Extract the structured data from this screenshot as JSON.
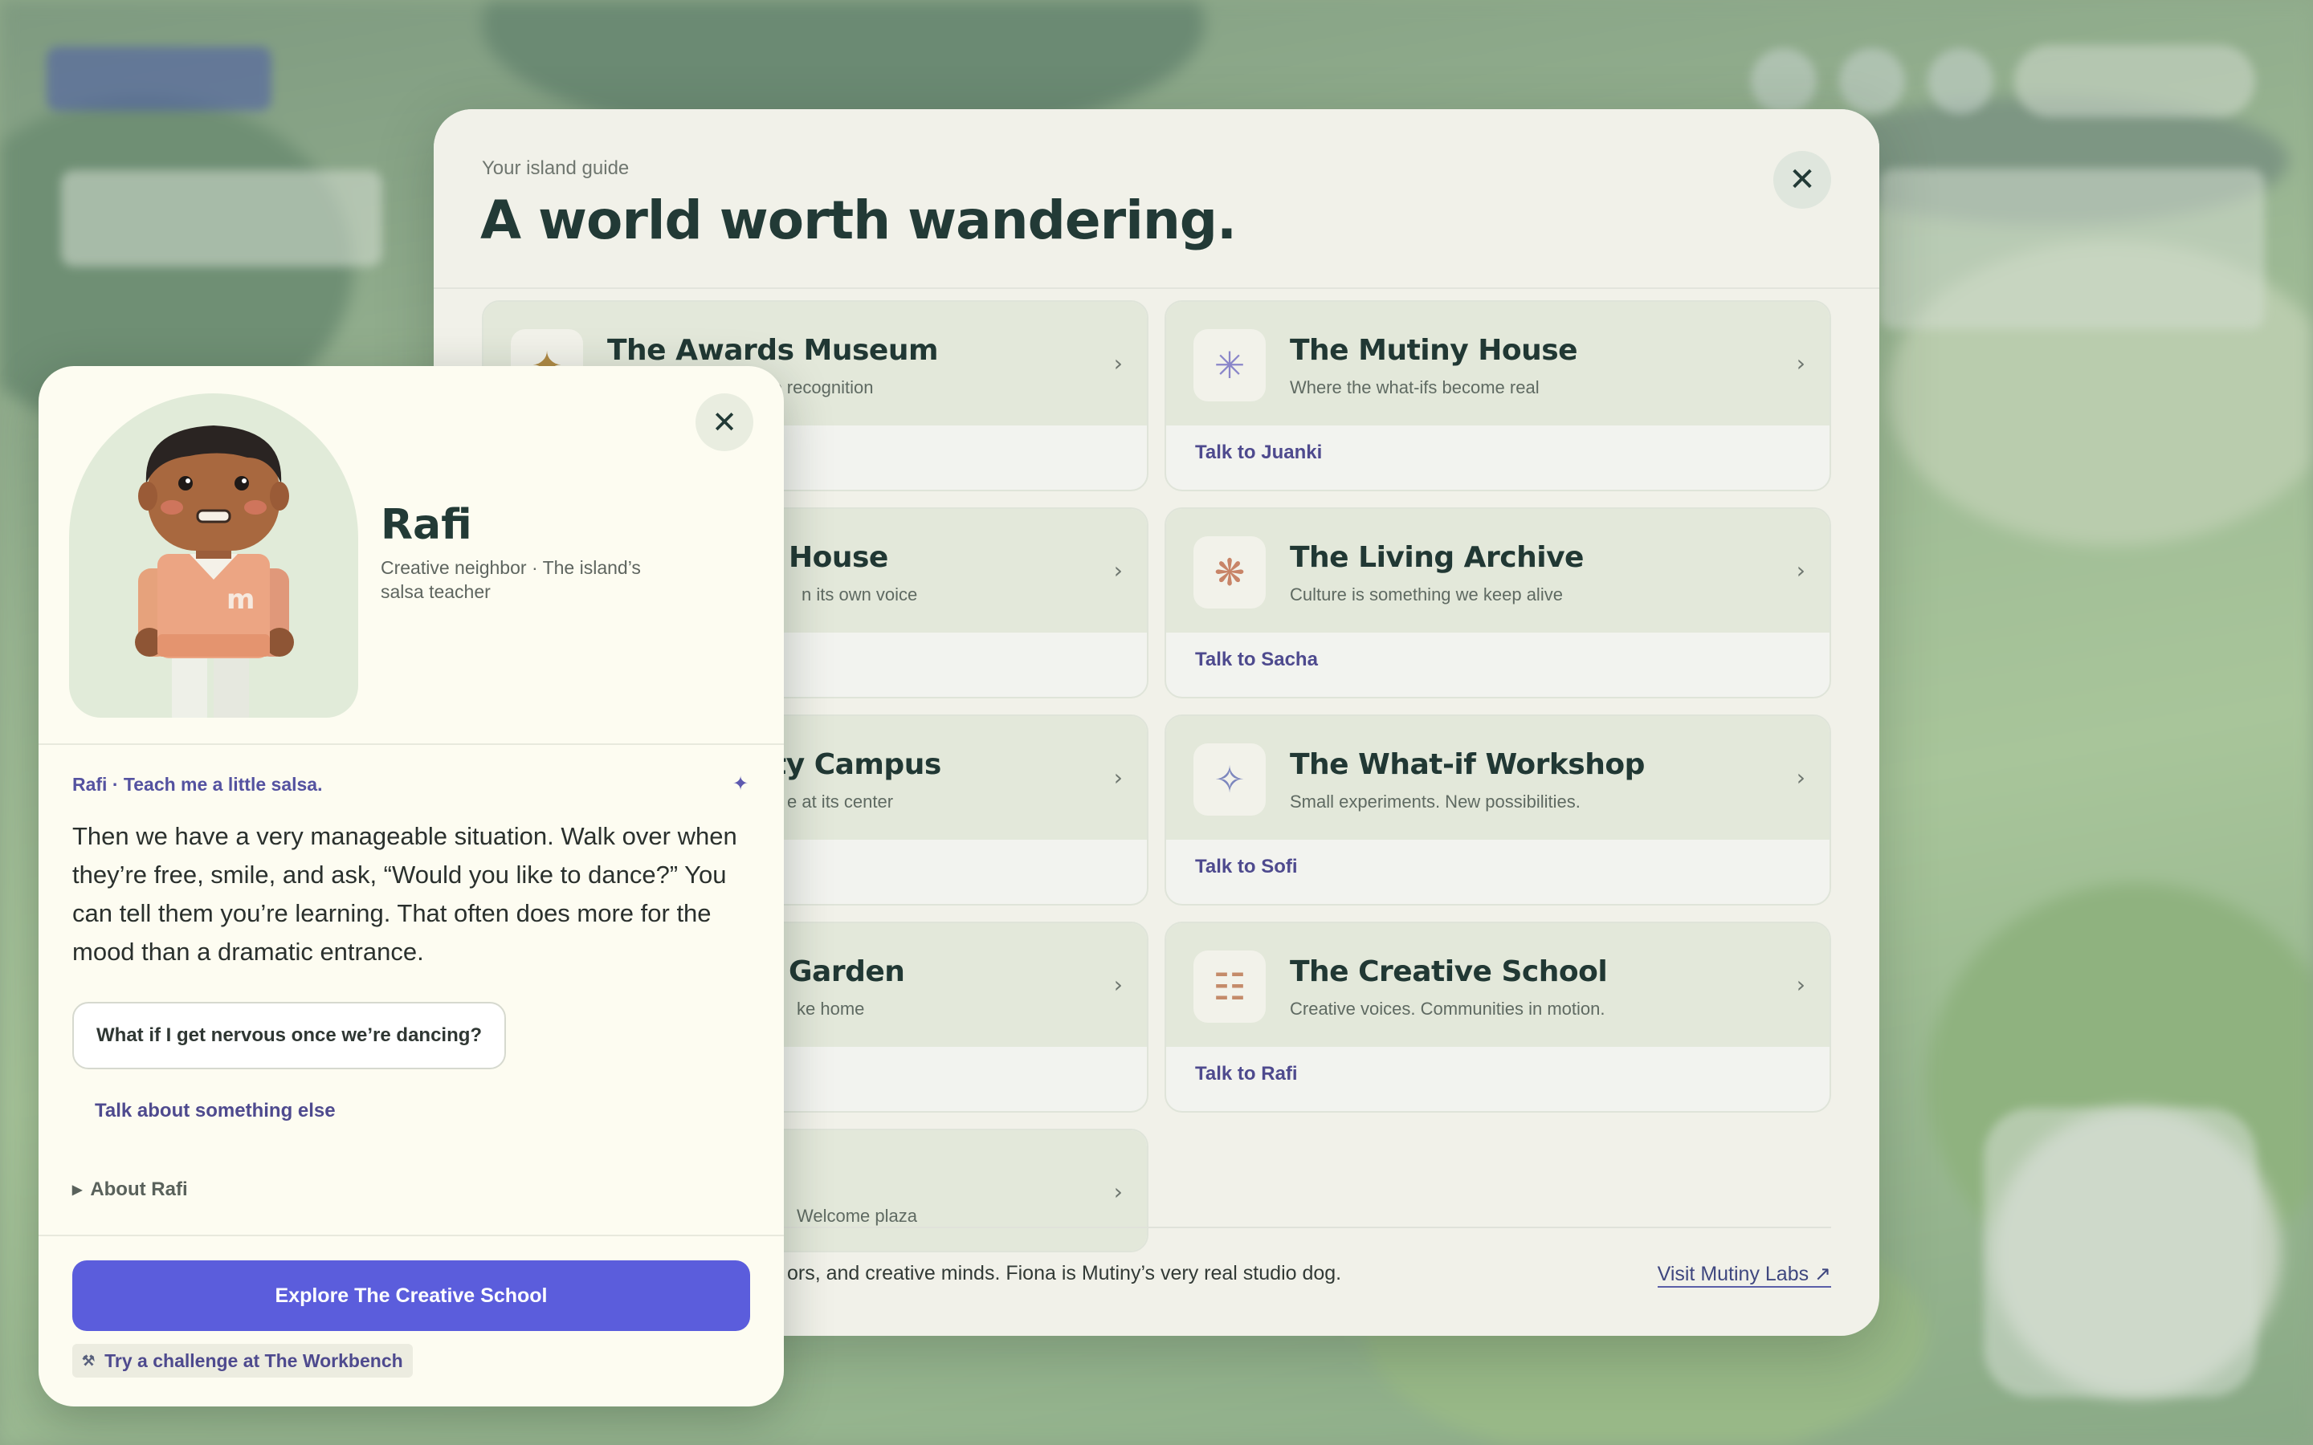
{
  "guide": {
    "eyebrow": "Your island guide",
    "title": "A world worth wandering.",
    "close_icon": "close-icon",
    "locations": [
      {
        "name": "The Awards Museum",
        "tagline": "The stories behind the recognition",
        "talk": "",
        "icon": "star-icon",
        "glyph": "✦",
        "icon_color": "#b08a45"
      },
      {
        "name": "The Mutiny House",
        "tagline": "Where the what-ifs become real",
        "talk": "Talk to Juanki",
        "icon": "asterisk-icon",
        "glyph": "✳",
        "icon_color": "#8a86c9"
      },
      {
        "name": "House",
        "tagline": "n its own voice",
        "talk": "",
        "icon": "",
        "glyph": "",
        "icon_color": "#000000"
      },
      {
        "name": "The Living Archive",
        "tagline": "Culture is something we keep alive",
        "talk": "Talk to Sacha",
        "icon": "flower-icon",
        "glyph": "❋",
        "icon_color": "#c88467"
      },
      {
        "name": "ty Campus",
        "tagline": "e at its center",
        "talk": "",
        "icon": "",
        "glyph": "",
        "icon_color": "#000000"
      },
      {
        "name": "The What-if Workshop",
        "tagline": "Small experiments. New possibilities.",
        "talk": "Talk to Sofi",
        "icon": "sparkle-icon",
        "glyph": "✧",
        "icon_color": "#7c86bd"
      },
      {
        "name": "Garden",
        "tagline": "ke home",
        "talk": "",
        "icon": "",
        "glyph": "",
        "icon_color": "#000000"
      },
      {
        "name": "The Creative School",
        "tagline": "Creative voices. Communities in motion.",
        "talk": "Talk to Rafi",
        "icon": "grid-icon",
        "glyph": "☷",
        "icon_color": "#c48b6a"
      },
      {
        "name": "",
        "tagline": "Welcome plaza",
        "talk": "",
        "icon": "",
        "glyph": "",
        "icon_color": "#000000"
      }
    ],
    "footer_text": "ors, and creative minds. Fiona is Mutiny’s very real studio dog.",
    "visit_link": "Visit Mutiny Labs ↗"
  },
  "character": {
    "name": "Rafi",
    "subtitle": "Creative neighbor · The island’s salsa teacher",
    "topic": "Rafi · Teach me a little salsa.",
    "message": "Then we have a very manageable situation. Walk over when they’re free, smile, and ask, “Would you like to dance?” You can tell them you’re learning. That often does more for the mood than a dramatic entrance.",
    "suggestion": "What if I get nervous once we’re dancing?",
    "something_else": "Talk about something else",
    "about": "About Rafi",
    "explore_button": "Explore The Creative School",
    "challenge_link": "Try a challenge at The Workbench",
    "portrait_icon": "rafi-avatar",
    "shirt_letter": "m"
  },
  "colors": {
    "accent": "#5b5ddc",
    "link": "#4e4a8e",
    "heading": "#223a36"
  }
}
